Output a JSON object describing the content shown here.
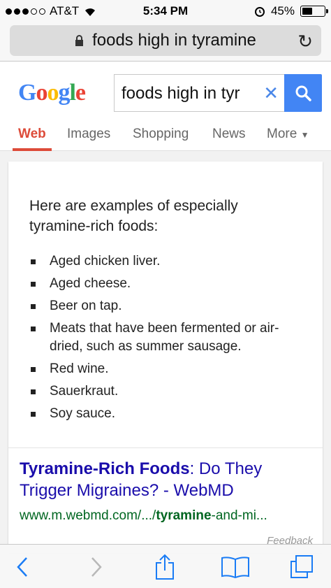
{
  "status": {
    "carrier": "AT&T",
    "time": "5:34 PM",
    "battery": "45%",
    "battery_level": 0.45
  },
  "url": {
    "text": "foods high in tyramine"
  },
  "google": {
    "logo_text": "Google",
    "search_value": "foods high in tyr",
    "tabs": [
      "Web",
      "Images",
      "Shopping",
      "News",
      "More"
    ]
  },
  "answer": {
    "intro": "Here are examples of especially tyramine-rich foods:",
    "items": [
      "Aged chicken liver.",
      "Aged cheese.",
      "Beer on tap.",
      "Meats that have been fermented or air-dried, such as summer sausage.",
      "Red wine.",
      "Sauerkraut.",
      "Soy sauce."
    ]
  },
  "result": {
    "title_bold": "Tyramine-Rich Foods",
    "title_rest": ": Do They Trigger Migraines? - WebMD",
    "url_prefix": "www.m.webmd.com/.../",
    "url_bold": "tyramine",
    "url_suffix": "-and-mi...",
    "feedback": "Feedback"
  },
  "colors": {
    "accent_blue": "#4285f4",
    "tab_red": "#dd4b39",
    "link_blue": "#1a0dab",
    "url_green": "#006621"
  }
}
